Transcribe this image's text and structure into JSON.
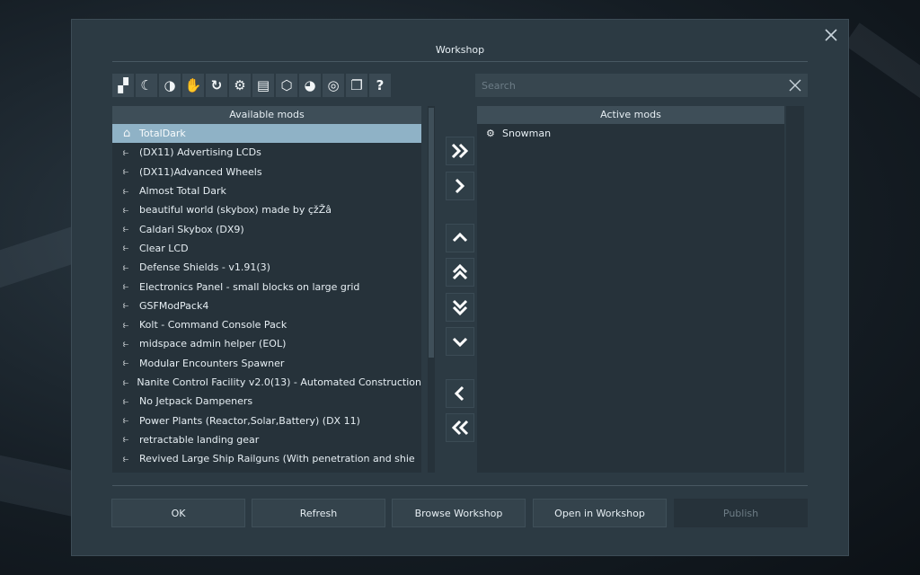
{
  "dialog": {
    "title": "Workshop",
    "close_label": "✕"
  },
  "toolbar": {
    "tools": [
      {
        "icon": "blocks-icon",
        "glyph": "▞"
      },
      {
        "icon": "moon-icon",
        "glyph": "☾"
      },
      {
        "icon": "planet-icon",
        "glyph": "◑"
      },
      {
        "icon": "hand-icon",
        "glyph": "✋"
      },
      {
        "icon": "refresh-icon",
        "glyph": "↻"
      },
      {
        "icon": "conveyor-icon",
        "glyph": "⚙"
      },
      {
        "icon": "script-icon",
        "glyph": "▤"
      },
      {
        "icon": "cube-icon",
        "glyph": "⬡"
      },
      {
        "icon": "palette-icon",
        "glyph": "◕"
      },
      {
        "icon": "orbit-icon",
        "glyph": "◎"
      },
      {
        "icon": "windows-icon",
        "glyph": "❐"
      },
      {
        "icon": "help-icon",
        "glyph": "?"
      }
    ]
  },
  "search": {
    "placeholder": "Search",
    "value": ""
  },
  "available": {
    "header": "Available mods",
    "items": [
      {
        "label": "TotalDark",
        "icon": "home-icon",
        "selected": true
      },
      {
        "label": "(DX11) Advertising LCDs",
        "icon": "workshop-icon"
      },
      {
        "label": "(DX11)Advanced Wheels",
        "icon": "workshop-icon"
      },
      {
        "label": "Almost Total Dark",
        "icon": "workshop-icon"
      },
      {
        "label": "beautiful world (skybox) made by çžŽâ",
        "icon": "workshop-icon"
      },
      {
        "label": "Caldari Skybox (DX9)",
        "icon": "workshop-icon"
      },
      {
        "label": "Clear LCD",
        "icon": "workshop-icon"
      },
      {
        "label": "Defense Shields - v1.91(3)",
        "icon": "workshop-icon"
      },
      {
        "label": "Electronics Panel - small blocks on large grid",
        "icon": "workshop-icon"
      },
      {
        "label": "GSFModPack4",
        "icon": "workshop-icon"
      },
      {
        "label": "Kolt - Command Console Pack",
        "icon": "workshop-icon"
      },
      {
        "label": "midspace admin helper (EOL)",
        "icon": "workshop-icon"
      },
      {
        "label": "Modular Encounters Spawner",
        "icon": "workshop-icon"
      },
      {
        "label": "Nanite Control Facility v2.0(13) - Automated Construction",
        "icon": "workshop-icon"
      },
      {
        "label": "No Jetpack Dampeners",
        "icon": "workshop-icon"
      },
      {
        "label": "Power Plants (Reactor,Solar,Battery) (DX 11)",
        "icon": "workshop-icon"
      },
      {
        "label": "retractable landing gear",
        "icon": "workshop-icon"
      },
      {
        "label": "Revived Large Ship Railguns (With penetration and shie",
        "icon": "workshop-icon"
      }
    ]
  },
  "active": {
    "header": "Active mods",
    "items": [
      {
        "label": "Snowman",
        "icon": "gear-icon"
      }
    ]
  },
  "arrows": {
    "add_all": "»",
    "add": "›",
    "move_up": "˄",
    "move_top": "⇞",
    "move_bottom": "⇟",
    "move_down": "˅",
    "remove": "‹",
    "remove_all": "«"
  },
  "buttons": {
    "ok": "OK",
    "refresh": "Refresh",
    "browse": "Browse Workshop",
    "open": "Open in Workshop",
    "publish": "Publish"
  }
}
